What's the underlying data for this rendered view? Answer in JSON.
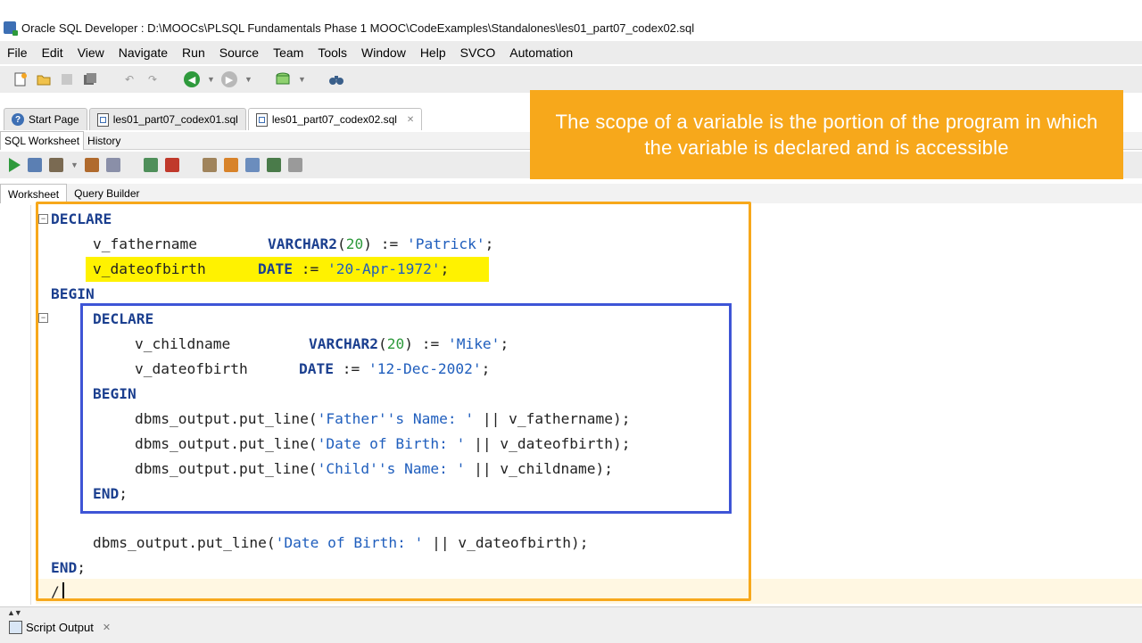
{
  "window": {
    "title": "Oracle SQL Developer : D:\\MOOCs\\PLSQL Fundamentals Phase 1 MOOC\\CodeExamples\\Standalones\\les01_part07_codex02.sql"
  },
  "menu": [
    "File",
    "Edit",
    "View",
    "Navigate",
    "Run",
    "Source",
    "Team",
    "Tools",
    "Window",
    "Help",
    "SVCO",
    "Automation"
  ],
  "tabs": [
    {
      "label": "Start Page",
      "icon": "help-icon"
    },
    {
      "label": "les01_part07_codex01.sql",
      "icon": "sql-file-icon"
    },
    {
      "label": "les01_part07_codex02.sql",
      "icon": "sql-file-icon",
      "active": true
    }
  ],
  "subtabs": [
    "SQL Worksheet",
    "History"
  ],
  "innertabs": [
    "Worksheet",
    "Query Builder"
  ],
  "callout": {
    "text": "The scope of a variable is the portion of the program in which the variable is declared and is accessible",
    "color": "#f7a81b"
  },
  "code": {
    "line1_kw": "DECLARE",
    "line2_var": "v_fathername",
    "line2_type": "VARCHAR2",
    "line2_paren_open": "(",
    "line2_num": "20",
    "line2_paren_close": ")",
    "line2_assign": " := ",
    "line2_str": "'Patrick'",
    "line2_end": ";",
    "line3_var": "v_dateofbirth",
    "line3_type": "DATE",
    "line3_assign": " := ",
    "line3_str": "'20-Apr-1972'",
    "line3_end": ";",
    "line4_kw": "BEGIN",
    "line5_kw": "DECLARE",
    "line6_var": "v_childname",
    "line6_type": "VARCHAR2",
    "line6_paren_open": "(",
    "line6_num": "20",
    "line6_paren_close": ")",
    "line6_assign": " := ",
    "line6_str": "'Mike'",
    "line6_end": ";",
    "line7_var": "v_dateofbirth",
    "line7_type": "DATE",
    "line7_assign": " := ",
    "line7_str": "'12-Dec-2002'",
    "line7_end": ";",
    "line8_kw": "BEGIN",
    "line9_pre": "dbms_output.put_line(",
    "line9_str": "'Father''s Name: '",
    "line9_post": " || v_fathername);",
    "line10_pre": "dbms_output.put_line(",
    "line10_str": "'Date of Birth: '",
    "line10_post": " || v_dateofbirth);",
    "line11_pre": "dbms_output.put_line(",
    "line11_str": "'Child''s Name: '",
    "line11_post": " || v_childname);",
    "line12_kw": "END",
    "line12_end": ";",
    "line13_pre": "dbms_output.put_line(",
    "line13_str": "'Date of Birth: '",
    "line13_post": " || v_dateofbirth);",
    "line14_kw": "END",
    "line14_end": ";",
    "line15": "/"
  },
  "bottom": {
    "script_output": "Script Output"
  },
  "colors": {
    "outer_box": "#f7a81b",
    "inner_box": "#3e55d6",
    "highlight": "#fff200"
  }
}
